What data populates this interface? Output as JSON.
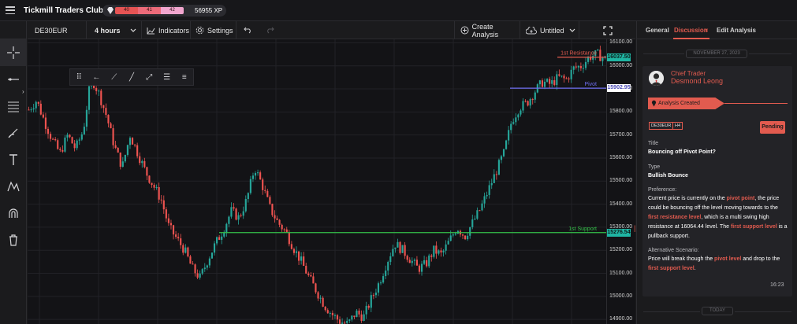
{
  "app": {
    "title": "Tickmill Traders Club",
    "xp_levels": [
      "40",
      "41",
      "42"
    ],
    "xp_value": "56955 XP"
  },
  "toolbar": {
    "symbol": "DE30EUR",
    "timeframe": "4 hours",
    "indicators_label": "Indicators",
    "settings_label": "Settings",
    "create_analysis_label": "Create Analysis",
    "layout_label": "Untitled"
  },
  "chart_data": {
    "type": "candlestick",
    "symbol": "DE30EUR",
    "timeframe": "4 hours",
    "ylim": [
      14880,
      16115
    ],
    "yticks": [
      16100,
      16000,
      15900,
      15800,
      15700,
      15600,
      15500,
      15400,
      15300,
      15200,
      15100,
      15000,
      14900
    ],
    "ytick_labels": [
      "16100.00",
      "16000.00",
      "15900.00",
      "15800.00",
      "15700.00",
      "15600.00",
      "15500.00",
      "15400.00",
      "15300.00",
      "15200.00",
      "15100.00",
      "15000.00",
      "14900.00"
    ],
    "price_path": [
      15810,
      15850,
      15760,
      15680,
      15620,
      15700,
      15640,
      15720,
      15950,
      15880,
      15780,
      15650,
      15560,
      15700,
      15620,
      15540,
      15480,
      15420,
      15300,
      15250,
      15200,
      15120,
      15080,
      15160,
      15230,
      15290,
      15370,
      15340,
      15420,
      15560,
      15480,
      15380,
      15320,
      15280,
      15210,
      15150,
      15080,
      15020,
      14960,
      14920,
      14890,
      14880,
      14930,
      14910,
      14990,
      15060,
      15150,
      15230,
      15200,
      15160,
      15120,
      15140,
      15200,
      15180,
      15240,
      15300,
      15260,
      15320,
      15380,
      15460,
      15540,
      15620,
      15760,
      15820,
      15840,
      15890,
      15930,
      15920,
      15950,
      15940,
      15990,
      16000,
      16040,
      16050,
      16030
    ],
    "levels": [
      {
        "label": "1st Resistance",
        "price": "16037.50",
        "value": 16037.5,
        "color": "#e25b4f"
      },
      {
        "label": "Pivot",
        "price": "15902.95",
        "value": 15902.95,
        "color": "#6e6ef0"
      },
      {
        "label": "1st Support",
        "price": "15276.54",
        "value": 15276.54,
        "color": "#35c24a"
      }
    ],
    "up_color": "#26a69a",
    "down_color": "#ef5350",
    "grid": true
  },
  "panel": {
    "tabs": [
      "General",
      "Discussion",
      "Edit Analysis"
    ],
    "active_tab": "Discussion",
    "date_top": "NOVEMBER 27, 2023",
    "author_role": "Chief Trader",
    "author_name": "Desmond Leong",
    "event": "Analysis Created",
    "tags": [
      "DE30EUR",
      "H4"
    ],
    "status": "Pending",
    "title_label": "Title",
    "title_value": "Bouncing off Pivot Point?",
    "type_label": "Type",
    "type_value": "Bullish Bounce",
    "preference_label": "Preference:",
    "preference_parts": [
      "Current price is currently on the ",
      "pivot point",
      ", the price could be bouncing off the level moving towards to the ",
      "first resistance level",
      ", which is a multi swing high resistance at 16064.44 level.  The ",
      "first support level",
      " is a pullback support."
    ],
    "alternative_label": "Alternative Scenario:",
    "alternative_parts": [
      "Price will break though the ",
      "pivot level",
      " and drop to the ",
      "first support level",
      "."
    ],
    "time": "16:23",
    "date_bottom": "TODAY"
  }
}
